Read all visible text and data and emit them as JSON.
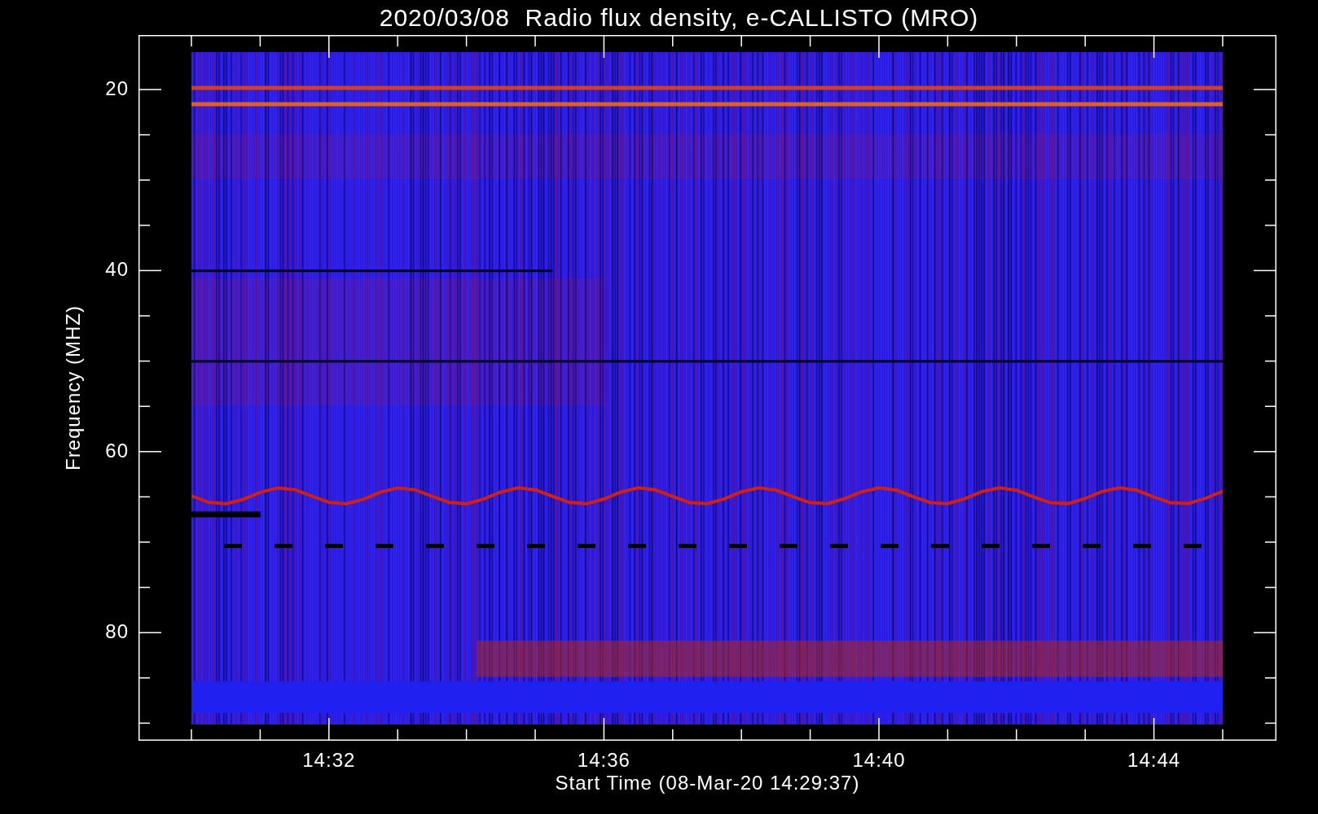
{
  "title": "2020/03/08  Radio flux density, e-CALLISTO (MRO)",
  "y_axis": {
    "label": "Frequency (MHZ)",
    "ticks": [
      "20",
      "40",
      "60",
      "80"
    ]
  },
  "x_axis": {
    "label": "Start Time (08-Mar-20 14:29:37)",
    "ticks": [
      "14:32",
      "14:36",
      "14:40",
      "14:44"
    ]
  }
}
